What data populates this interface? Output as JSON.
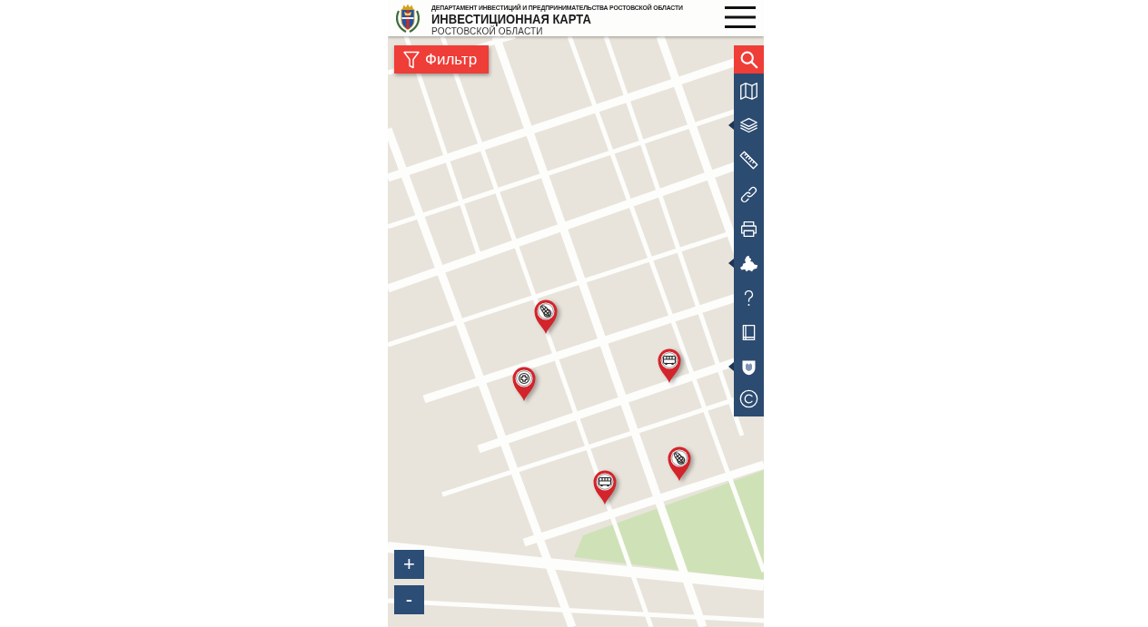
{
  "header": {
    "department": "ДЕПАРТАМЕНТ ИНВЕСТИЦИЙ И ПРЕДПРИНИМАТЕЛЬСТВА РОСТОВСКОЙ ОБЛАСТИ",
    "title": "ИНВЕСТИЦИОННАЯ КАРТА",
    "subtitle": "РОСТОВСКОЙ ОБЛАСТИ"
  },
  "filter_button": {
    "label": "Фильтр"
  },
  "toolbar": {
    "tools": [
      {
        "kind": "search",
        "has_submenu": false
      },
      {
        "kind": "map",
        "has_submenu": false
      },
      {
        "kind": "layers",
        "has_submenu": true
      },
      {
        "kind": "ruler",
        "has_submenu": false
      },
      {
        "kind": "link",
        "has_submenu": false
      },
      {
        "kind": "print",
        "has_submenu": false
      },
      {
        "kind": "region",
        "has_submenu": true
      },
      {
        "kind": "help",
        "has_submenu": false
      },
      {
        "kind": "book",
        "has_submenu": false
      },
      {
        "kind": "emblem",
        "has_submenu": true
      },
      {
        "kind": "copyright",
        "has_submenu": false
      }
    ]
  },
  "markers": [
    {
      "kind": "agriculture"
    },
    {
      "kind": "transport"
    },
    {
      "kind": "medical"
    },
    {
      "kind": "agriculture"
    },
    {
      "kind": "transport"
    }
  ],
  "zoom": {
    "zoom_in": "+",
    "zoom_out": "-"
  }
}
